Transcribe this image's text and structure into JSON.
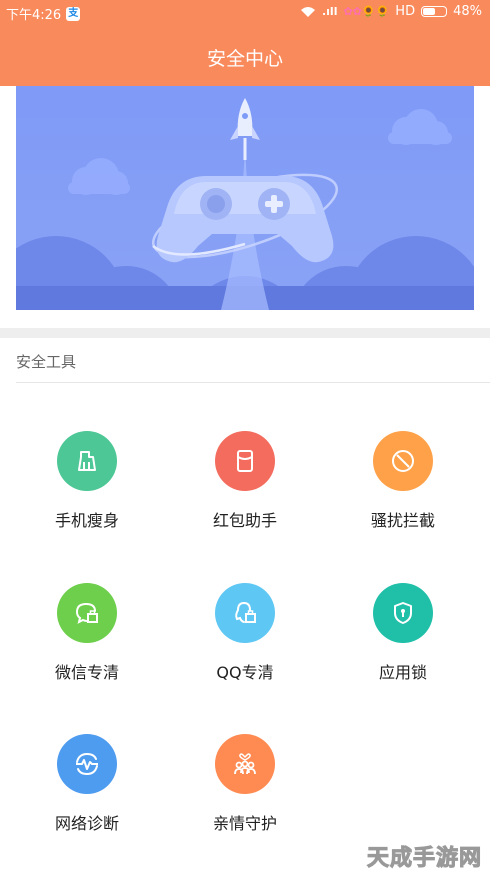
{
  "status_bar": {
    "time": "下午4:26",
    "app_badge": "支",
    "signal": ".ıll",
    "network": "HD",
    "battery": "48%",
    "battery_level": 0.48,
    "emoji": "✿✿🌻🌻"
  },
  "header": {
    "title": "安全中心"
  },
  "section": {
    "title": "安全工具"
  },
  "tools": [
    {
      "label": "手机瘦身",
      "color": "#4cc795",
      "icon": "broom-icon"
    },
    {
      "label": "红包助手",
      "color": "#f36c5d",
      "icon": "red-packet-icon"
    },
    {
      "label": "骚扰拦截",
      "color": "#ffa149",
      "icon": "block-icon"
    },
    {
      "label": "微信专清",
      "color": "#6dcf4b",
      "icon": "wechat-clean-icon"
    },
    {
      "label": "QQ专清",
      "color": "#5ec7f4",
      "icon": "qq-clean-icon"
    },
    {
      "label": "应用锁",
      "color": "#1fbfa8",
      "icon": "shield-lock-icon"
    },
    {
      "label": "网络诊断",
      "color": "#4e9cf0",
      "icon": "network-pulse-icon"
    },
    {
      "label": "亲情守护",
      "color": "#ff8a52",
      "icon": "family-icon"
    }
  ],
  "watermark": "天成手游网"
}
